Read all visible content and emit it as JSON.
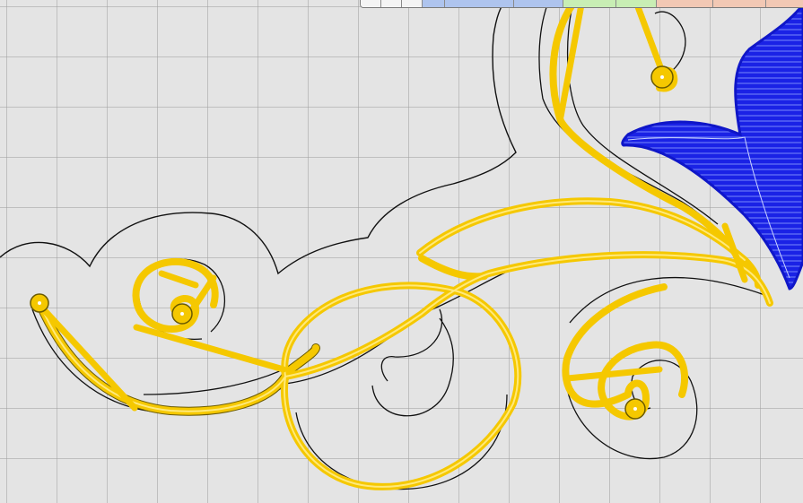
{
  "palette": {
    "swatches": [
      {
        "color": "#f4f4f4",
        "width": 22
      },
      {
        "color": "#f4f4f4",
        "width": 22
      },
      {
        "color": "#f4f4f4",
        "width": 22
      },
      {
        "color": "#aec4ee",
        "width": 24
      },
      {
        "color": "#aec4ee",
        "width": 76
      },
      {
        "color": "#aec4ee",
        "width": 54
      },
      {
        "color": "#c8eeb4",
        "width": 58
      },
      {
        "color": "#c8eeb4",
        "width": 44
      },
      {
        "color": "#f2c8b4",
        "width": 62
      },
      {
        "color": "#f2c8b4",
        "width": 58
      },
      {
        "color": "#f2c8b4",
        "width": 44
      }
    ]
  },
  "colors": {
    "canvas_bg": "#e4e4e4",
    "grid_line": "#a0a0a0",
    "outline": "#111111",
    "selected_path": "#f5c800",
    "selected_path_center": "#ffe97a",
    "fill_region": "#1a22e6",
    "fill_hatch": "#9fb0ff"
  }
}
